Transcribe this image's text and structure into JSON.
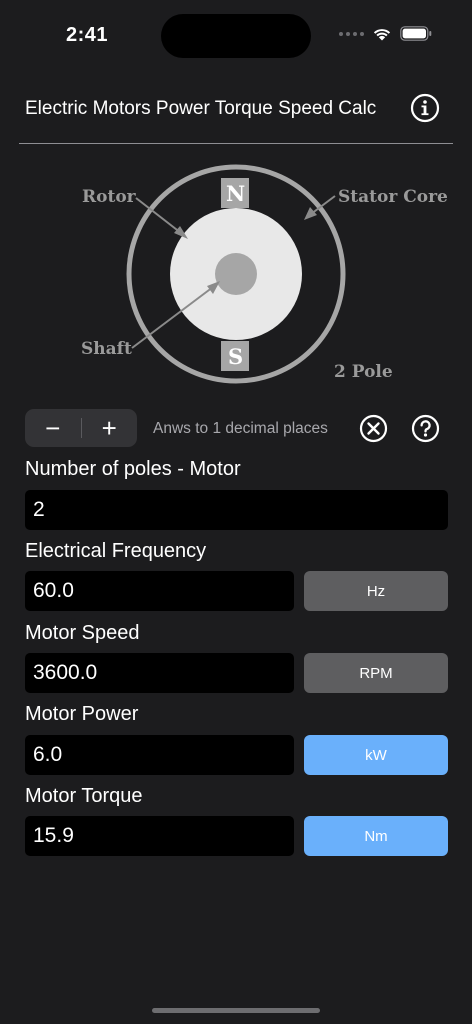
{
  "status": {
    "time": "2:41"
  },
  "header": {
    "title": "Electric Motors Power Torque Speed Calc",
    "info_icon": "info-circle-icon"
  },
  "diagram": {
    "label_north": "N",
    "label_south": "S",
    "label_rotor": "Rotor",
    "label_stator": "Stator Core",
    "label_shaft": "Shaft",
    "label_poles": "2 Pole"
  },
  "controls": {
    "minus": "−",
    "plus": "+",
    "decimals_text": "Anws to 1 decimal places",
    "clear_icon": "clear-circle-x-icon",
    "help_icon": "question-circle-icon"
  },
  "fields": [
    {
      "label": "Number of poles - Motor",
      "value": "2"
    },
    {
      "label": "Electrical Frequency",
      "value": "60.0",
      "unit": "Hz"
    },
    {
      "label": "Motor Speed",
      "value": "3600.0",
      "unit": "RPM"
    },
    {
      "label": "Motor Power",
      "value": "6.0",
      "unit": "kW"
    },
    {
      "label": "Motor Torque",
      "value": "15.9",
      "unit": "Nm"
    }
  ],
  "colors": {
    "background": "#1c1c1e",
    "input_background": "#000000",
    "unit_gray": "#5e5e60",
    "unit_blue": "#6ab0fb",
    "diagram_gray": "#a6a6a6",
    "diagram_light": "#e8e8e8"
  }
}
